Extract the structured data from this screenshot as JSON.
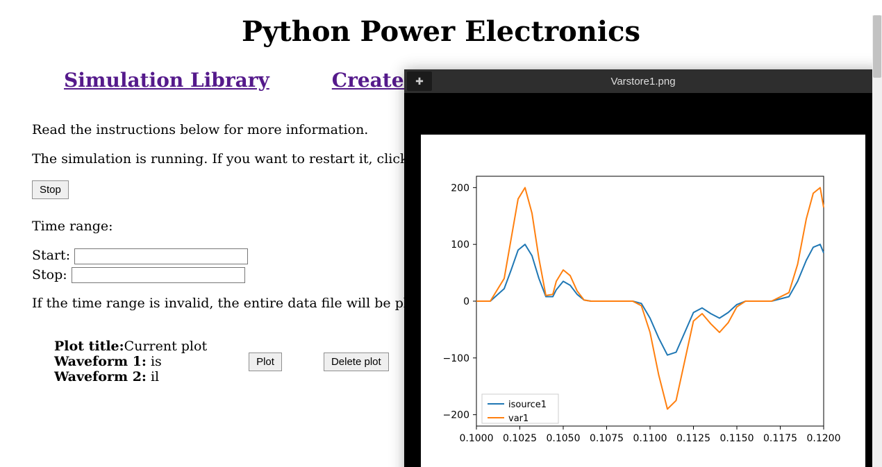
{
  "page_title": "Python Power Electronics",
  "nav": {
    "sim_library": "Simulation Library",
    "create_sim": "Create Simulation"
  },
  "instructions_line": "Read the instructions below for more information.",
  "running_line": "The simulation is running. If you want to restart it, click on the Stop button below.",
  "stop_label": "Stop",
  "time_range_label": "Time range:",
  "start_label": "Start:",
  "start_value": "",
  "stop_field_label": "Stop:",
  "stop_value": "",
  "invalid_range_line": "If the time range is invalid, the entire data file will be plotted.",
  "plot": {
    "title_label": "Plot title:",
    "title_value": "Current plot",
    "wave1_label": "Waveform 1:",
    "wave1_value": " is",
    "wave2_label": "Waveform 2:",
    "wave2_value": " il",
    "plot_btn": "Plot",
    "delete_btn": "Delete plot"
  },
  "viewer": {
    "filename": "Varstore1.png",
    "window_btn_icon": "plus-icon"
  },
  "chart_data": {
    "type": "line",
    "title": "",
    "xlabel": "",
    "ylabel": "",
    "xlim": [
      0.1,
      0.12
    ],
    "ylim": [
      -220,
      220
    ],
    "xticks": [
      0.1,
      0.1025,
      0.105,
      0.1075,
      0.11,
      0.1125,
      0.115,
      0.1175,
      0.12
    ],
    "yticks": [
      -200,
      -100,
      0,
      100,
      200
    ],
    "legend": [
      "isource1",
      "var1"
    ],
    "legend_pos": "lower-left",
    "series": [
      {
        "name": "isource1",
        "color": "#1f77b4",
        "x": [
          0.1,
          0.1008,
          0.1016,
          0.102,
          0.1024,
          0.1028,
          0.1032,
          0.1036,
          0.104,
          0.1044,
          0.1046,
          0.105,
          0.1054,
          0.1058,
          0.1062,
          0.1066,
          0.107,
          0.109,
          0.1095,
          0.11,
          0.1105,
          0.111,
          0.1115,
          0.112,
          0.1125,
          0.113,
          0.1135,
          0.114,
          0.1145,
          0.115,
          0.1155,
          0.116,
          0.117,
          0.118,
          0.1185,
          0.119,
          0.1194,
          0.1198,
          0.12
        ],
        "y": [
          0,
          0,
          22,
          55,
          90,
          100,
          80,
          40,
          8,
          8,
          20,
          35,
          28,
          12,
          2,
          0,
          0,
          0,
          -4,
          -30,
          -65,
          -95,
          -90,
          -55,
          -20,
          -12,
          -22,
          -30,
          -20,
          -6,
          0,
          0,
          0,
          8,
          35,
          72,
          95,
          100,
          85
        ]
      },
      {
        "name": "var1",
        "color": "#ff7f0e",
        "x": [
          0.1,
          0.1008,
          0.1016,
          0.102,
          0.1024,
          0.1028,
          0.1032,
          0.1036,
          0.104,
          0.1044,
          0.1046,
          0.105,
          0.1054,
          0.1058,
          0.1062,
          0.1066,
          0.107,
          0.109,
          0.1095,
          0.11,
          0.1105,
          0.111,
          0.1115,
          0.112,
          0.1125,
          0.113,
          0.1135,
          0.114,
          0.1145,
          0.115,
          0.1155,
          0.116,
          0.117,
          0.118,
          0.1185,
          0.119,
          0.1194,
          0.1198,
          0.12
        ],
        "y": [
          0,
          0,
          40,
          110,
          180,
          200,
          155,
          75,
          10,
          12,
          35,
          55,
          45,
          18,
          2,
          0,
          0,
          0,
          -8,
          -55,
          -130,
          -190,
          -175,
          -105,
          -35,
          -22,
          -40,
          -55,
          -38,
          -10,
          0,
          0,
          0,
          15,
          65,
          145,
          190,
          200,
          165
        ]
      }
    ]
  }
}
